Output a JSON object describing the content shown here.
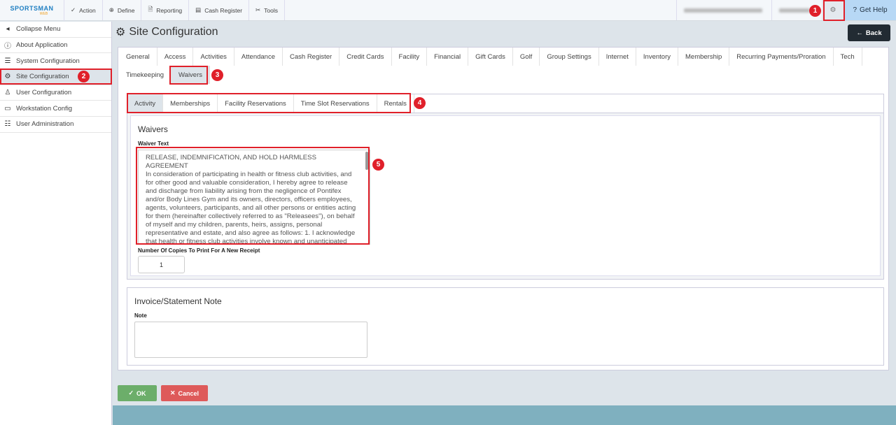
{
  "topbar": {
    "logo": "SPORTSMAN",
    "logo_sub": "WEB",
    "menu": [
      "Action",
      "Define",
      "Reporting",
      "Cash Register",
      "Tools"
    ],
    "help": "Get Help"
  },
  "sidebar": {
    "items": [
      "Collapse Menu",
      "About Application",
      "System Configuration",
      "Site Configuration",
      "User Configuration",
      "Workstation Config",
      "User Administration"
    ]
  },
  "page": {
    "title": "Site Configuration",
    "back": "Back"
  },
  "tabs": [
    "General",
    "Access",
    "Activities",
    "Attendance",
    "Cash Register",
    "Credit Cards",
    "Facility",
    "Financial",
    "Gift Cards",
    "Golf",
    "Group Settings",
    "Internet",
    "Inventory",
    "Membership",
    "Recurring Payments/Proration",
    "Tech",
    "Timekeeping",
    "Waivers"
  ],
  "subtabs": [
    "Activity",
    "Memberships",
    "Facility Reservations",
    "Time Slot Reservations",
    "Rentals"
  ],
  "waivers": {
    "heading": "Waivers",
    "text_label": "Waiver Text",
    "text": "RELEASE, INDEMNIFICATION, AND HOLD HARMLESS AGREEMENT\nIn consideration of participating in health or fitness club activities, and for other good and valuable consideration, I hereby agree to release and discharge from liability arising from the negligence of Pontifex and/or Body Lines Gym and its owners, directors, officers employees, agents, volunteers, participants, and all other persons or entities acting for them (hereinafter collectively referred to as \"Releasees\"), on behalf of myself and my children, parents, heirs, assigns, personal representative and estate, and also agree as follows: 1. I acknowledge that health or fitness club activities involve known and unanticipated risks which could result in physical or emotional injury, paralysis or permanent disability, death, and",
    "copies_label": "Number Of Copies To Print For A New Receipt",
    "copies": "1"
  },
  "invoice": {
    "heading": "Invoice/Statement Note",
    "note_label": "Note",
    "note": ""
  },
  "buttons": {
    "ok": "OK",
    "cancel": "Cancel"
  },
  "annotations": [
    "1",
    "2",
    "3",
    "4",
    "5"
  ]
}
